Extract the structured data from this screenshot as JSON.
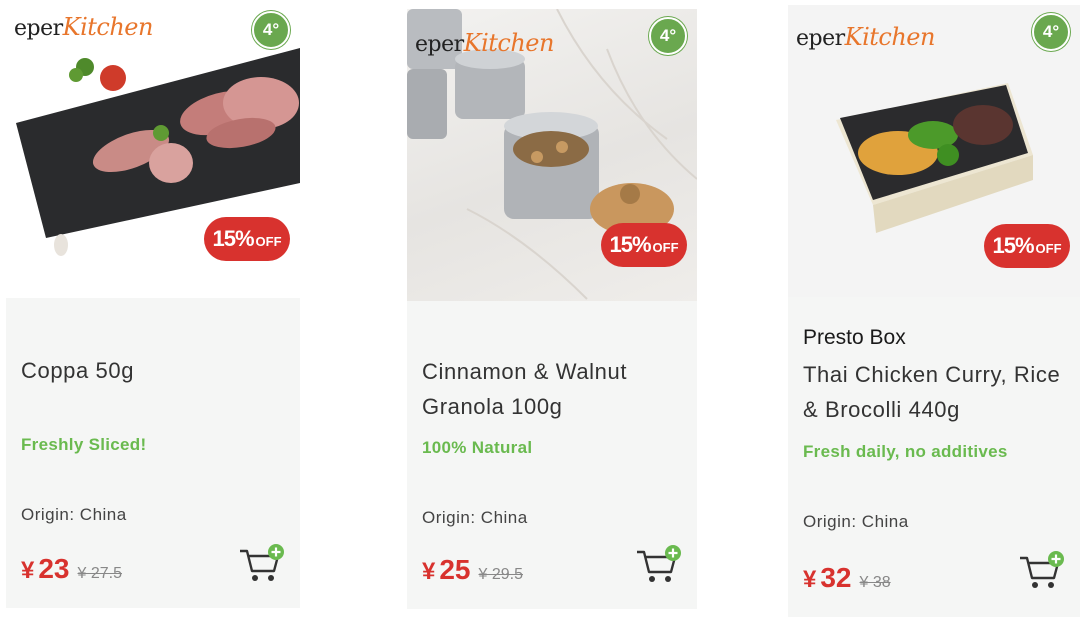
{
  "brand": {
    "logo_text_prefix": "eper",
    "logo_text_suffix": "Kitchen",
    "temperature": "4°"
  },
  "colors": {
    "accent_green": "#6aba4f",
    "price_red": "#d8322e",
    "card_bg": "#f5f6f5"
  },
  "products": [
    {
      "discount_pct": "15%",
      "discount_suffix": "OFF",
      "name": "Coppa 50g",
      "tagline": "Freshly Sliced!",
      "origin": "Origin: China",
      "currency": "¥",
      "price": "23",
      "old_price": "¥ 27.5",
      "cart_icon": "add-to-cart-icon"
    },
    {
      "discount_pct": "15%",
      "discount_suffix": "OFF",
      "name": "Cinnamon & Walnut Granola 100g",
      "tagline": "100% Natural",
      "origin": "Origin: China",
      "currency": "¥",
      "price": "25",
      "old_price": "¥ 29.5",
      "cart_icon": "add-to-cart-icon"
    },
    {
      "discount_pct": "15%",
      "discount_suffix": "OFF",
      "subtitle": "Presto Box",
      "name": "Thai Chicken Curry, Rice & Brocolli 440g",
      "tagline": "Fresh daily, no additives",
      "origin": "Origin: China",
      "currency": "¥",
      "price": "32",
      "old_price": "¥ 38",
      "cart_icon": "add-to-cart-icon"
    }
  ]
}
